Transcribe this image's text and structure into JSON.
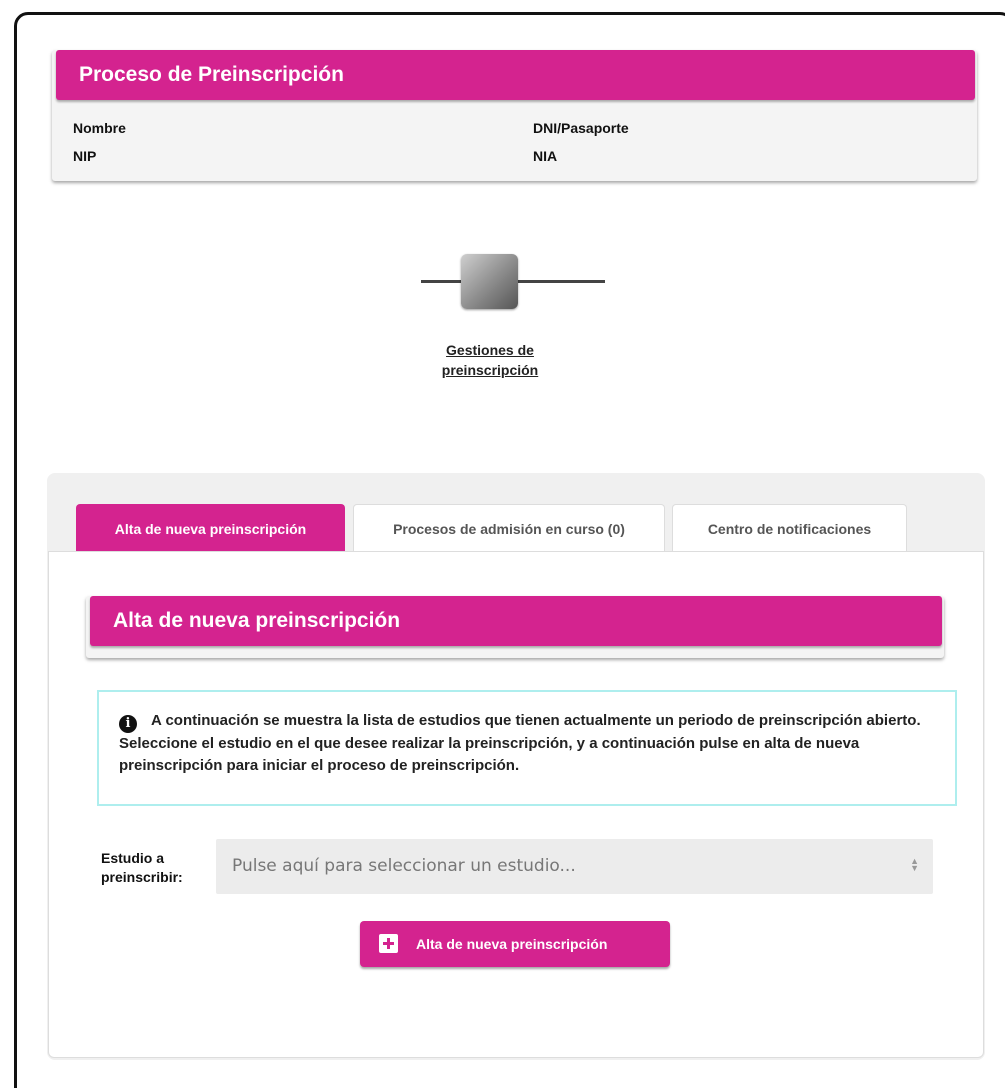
{
  "header": {
    "title": "Proceso de Preinscripción",
    "fields": {
      "nombre": "Nombre",
      "dni": "DNI/Pasaporte",
      "nip": "NIP",
      "nia": "NIA"
    }
  },
  "steps": [
    {
      "label": "Gestiones de preinscripción"
    }
  ],
  "tabs": [
    {
      "label": "Alta de nueva preinscripción",
      "active": true
    },
    {
      "label": "Procesos de admisión en curso (0)",
      "active": false
    },
    {
      "label": "Centro de notificaciones",
      "active": false
    }
  ],
  "section": {
    "title": "Alta de nueva preinscripción",
    "info_icon": "info-circle-icon",
    "info_text": "A continuación se muestra la lista de estudios que tienen actualmente un periodo de preinscripción abierto. Seleccione el estudio en el que desee realizar la preinscripción, y a continuación pulse en alta de nueva preinscripción para iniciar el proceso de preinscripción.",
    "select_label": "Estudio a preinscribir:",
    "select_placeholder": "Pulse aquí para seleccionar un estudio...",
    "button_icon": "plus-square-icon",
    "button_label": "Alta de nueva preinscripción"
  },
  "colors": {
    "accent": "#d4238f",
    "info_border": "#aeeeee"
  }
}
